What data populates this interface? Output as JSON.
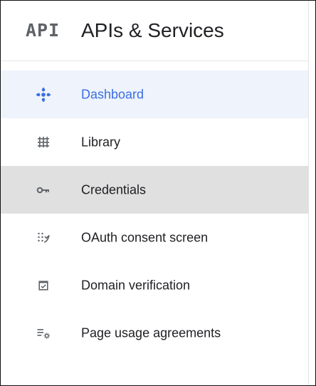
{
  "header": {
    "logo_text": "API",
    "title": "APIs & Services"
  },
  "nav": {
    "items": [
      {
        "label": "Dashboard",
        "icon": "dashboard-icon",
        "state": "active"
      },
      {
        "label": "Library",
        "icon": "library-icon",
        "state": "normal"
      },
      {
        "label": "Credentials",
        "icon": "key-icon",
        "state": "hover"
      },
      {
        "label": "OAuth consent screen",
        "icon": "oauth-consent-icon",
        "state": "normal"
      },
      {
        "label": "Domain verification",
        "icon": "domain-verification-icon",
        "state": "normal"
      },
      {
        "label": "Page usage agreements",
        "icon": "page-usage-agreements-icon",
        "state": "normal"
      }
    ]
  },
  "colors": {
    "accent": "#3b6ee0",
    "active_bg": "#eef3fc",
    "hover_bg": "#e0e0e0",
    "icon_gray": "#5f6368",
    "text": "#202124"
  }
}
